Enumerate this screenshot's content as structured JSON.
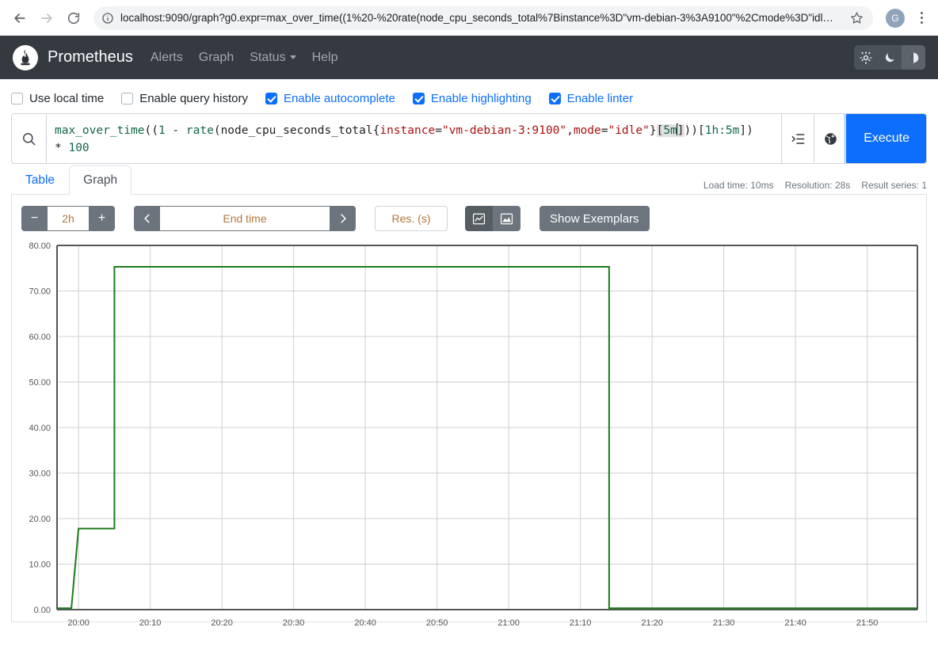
{
  "browser": {
    "url": "localhost:9090/graph?g0.expr=max_over_time((1%20-%20rate(node_cpu_seconds_total%7Binstance%3D\"vm-debian-3%3A9100\"%2Cmode%3D\"idl…",
    "profile_initial": "G",
    "icons": {
      "back": "back-arrow-icon",
      "forward": "forward-arrow-icon",
      "reload": "reload-icon",
      "site_info": "site-info-icon",
      "bookmark": "star-icon",
      "menu": "kebab-menu-icon"
    }
  },
  "navbar": {
    "brand": "Prometheus",
    "links": [
      {
        "label": "Alerts",
        "has_caret": false
      },
      {
        "label": "Graph",
        "has_caret": false
      },
      {
        "label": "Status",
        "has_caret": true
      },
      {
        "label": "Help",
        "has_caret": false
      }
    ],
    "theme_buttons": [
      {
        "icon": "sun-icon",
        "active": false
      },
      {
        "icon": "moon-icon",
        "active": false
      },
      {
        "icon": "auto-contrast-icon",
        "active": true
      }
    ]
  },
  "options": [
    {
      "label": "Use local time",
      "checked": false
    },
    {
      "label": "Enable query history",
      "checked": false
    },
    {
      "label": "Enable autocomplete",
      "checked": true
    },
    {
      "label": "Enable highlighting",
      "checked": true
    },
    {
      "label": "Enable linter",
      "checked": true
    }
  ],
  "query": {
    "search_icon": "search-icon",
    "expression": "max_over_time((1 - rate(node_cpu_seconds_total{instance=\"vm-debian-3:9100\",mode=\"idle\"}[5m]))[1h:5m]) * 100",
    "metrics_explorer_icon": "metrics-explorer-icon",
    "globe_icon": "globe-icon",
    "execute_label": "Execute"
  },
  "meta": {
    "load_time": "Load time: 10ms",
    "resolution": "Resolution: 28s",
    "result_series": "Result series: 1"
  },
  "tabs": [
    {
      "label": "Table",
      "active": false
    },
    {
      "label": "Graph",
      "active": true
    }
  ],
  "controls": {
    "decrease_range": "−",
    "range_value": "2h",
    "increase_range": "+",
    "prev_label": "‹",
    "end_time_placeholder": "End time",
    "next_label": "›",
    "resolution_placeholder": "Res. (s)",
    "graph_type": [
      {
        "icon": "line-chart-icon",
        "active": true
      },
      {
        "icon": "stacked-area-chart-icon",
        "active": false
      }
    ],
    "show_exemplars_label": "Show Exemplars"
  },
  "chart_data": {
    "type": "line",
    "title": "",
    "xlabel": "",
    "ylabel": "",
    "ylim": [
      0,
      80
    ],
    "yticks": [
      0,
      10,
      20,
      30,
      40,
      50,
      60,
      70,
      80
    ],
    "ytick_labels": [
      "0.00",
      "10.00",
      "20.00",
      "30.00",
      "40.00",
      "50.00",
      "60.00",
      "70.00",
      "80.00"
    ],
    "xticks": [
      "20:00",
      "20:10",
      "20:20",
      "20:30",
      "20:40",
      "20:50",
      "21:00",
      "21:10",
      "21:20",
      "21:30",
      "21:40",
      "21:50"
    ],
    "xlim": [
      "19:57",
      "21:57"
    ],
    "grid": true,
    "legend": "none",
    "series": [
      {
        "name": "max_over_time((1 - rate(node_cpu_seconds_total{instance=\"vm-debian-3:9100\",mode=\"idle\"}[5m]))[1h:5m]) * 100",
        "color": "#1a7c1a",
        "points": [
          {
            "t": "19:57",
            "v": 0.3
          },
          {
            "t": "19:59",
            "v": 0.3
          },
          {
            "t": "20:00",
            "v": 17.8
          },
          {
            "t": "20:05",
            "v": 17.8
          },
          {
            "t": "20:05",
            "v": 75.3
          },
          {
            "t": "21:14",
            "v": 75.3
          },
          {
            "t": "21:14",
            "v": 0.3
          },
          {
            "t": "21:57",
            "v": 0.3
          }
        ]
      }
    ]
  }
}
